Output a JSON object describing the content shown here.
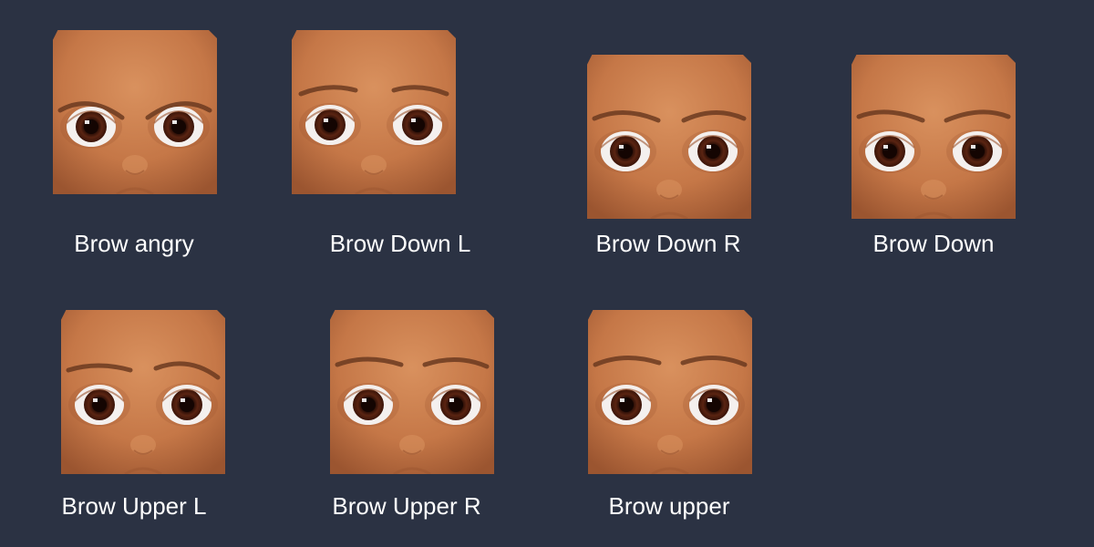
{
  "colors": {
    "background": "#2b3243",
    "label_text": "#ffffff",
    "skin_light": "#d9915e",
    "skin_mid": "#c57747",
    "skin_dark": "#9b5530",
    "brow": "#6b3a20",
    "iris": "#5a2412",
    "sclera": "#f4f0ee"
  },
  "expressions": [
    {
      "label": "Brow angry",
      "image": "face-brow-angry"
    },
    {
      "label": "Brow Down L",
      "image": "face-brow-down-l"
    },
    {
      "label": "Brow Down R",
      "image": "face-brow-down-r"
    },
    {
      "label": "Brow Down",
      "image": "face-brow-down"
    },
    {
      "label": "Brow Upper L",
      "image": "face-brow-upper-l"
    },
    {
      "label": "Brow Upper R",
      "image": "face-brow-upper-r"
    },
    {
      "label": "Brow upper",
      "image": "face-brow-upper"
    }
  ]
}
